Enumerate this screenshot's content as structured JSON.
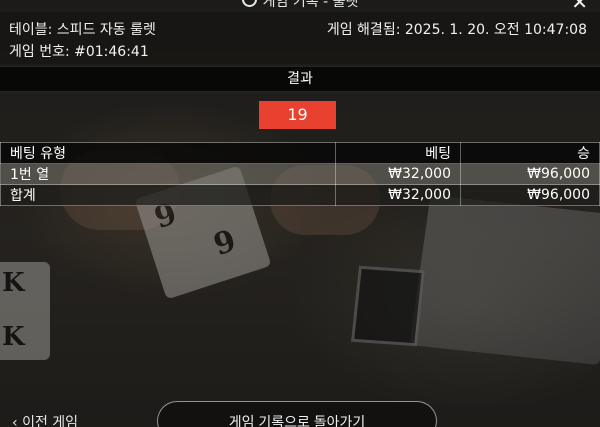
{
  "window": {
    "title": "게임 기록 - 룰렛",
    "title_icon": "history-icon",
    "close_label": "✕"
  },
  "info": {
    "table": "테이블: 스피드 자동 룰렛",
    "resolved": "게임 해결됨: 2025. 1. 20. 오전 10:47:08",
    "game_number": "게임 번호: #01:46:41"
  },
  "result": {
    "label": "결과",
    "number": "19",
    "number_color": "#e8412f"
  },
  "bets": {
    "headers": [
      "베팅 유형",
      "베팅",
      "승"
    ],
    "rows": [
      {
        "type": "1번 열",
        "bet": "₩32,000",
        "win": "₩96,000"
      },
      {
        "type": "합계",
        "bet": "₩32,000",
        "win": "₩96,000"
      }
    ]
  },
  "footer": {
    "prev_label": "이전 게임",
    "prev_icon": "chevron-left-icon",
    "back_label": "게임 기록으로 돌아가기"
  }
}
